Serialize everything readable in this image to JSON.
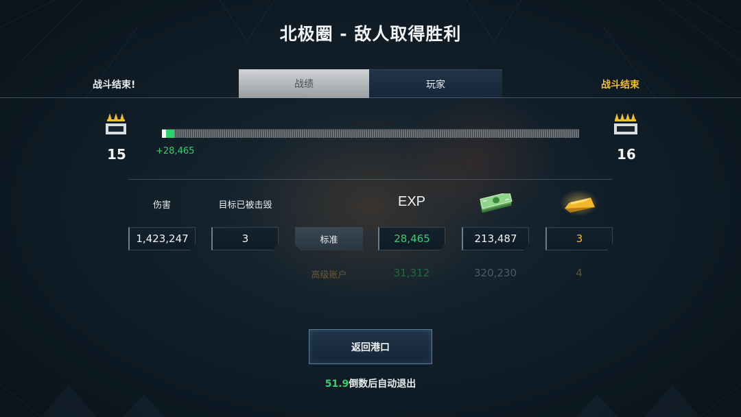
{
  "header": {
    "title": "北极圈 - 敌人取得胜利",
    "left_status": "战斗结束!",
    "right_status": "战斗结束"
  },
  "tabs": [
    {
      "label": "战绩",
      "active": true
    },
    {
      "label": "玩家",
      "active": false
    }
  ],
  "teams": {
    "left": {
      "score": "15",
      "icon": "rank-icon"
    },
    "right": {
      "score": "16",
      "icon": "rank-icon"
    }
  },
  "progress": {
    "gain_text": "+28,465",
    "fill_fraction": 0.03
  },
  "columns": {
    "damage": "伤害",
    "targets_destroyed": "目标已被击毁",
    "exp": "EXP",
    "credits_icon": "money-icon",
    "gold_icon": "gold-bar-icon"
  },
  "standard_row": {
    "label": "标准",
    "damage": "1,423,247",
    "targets_destroyed": "3",
    "exp": "28,465",
    "credits": "213,487",
    "gold": "3"
  },
  "premium_row": {
    "label": "高级账户",
    "exp": "31,312",
    "credits": "320,230",
    "gold": "4"
  },
  "footer": {
    "return_button": "返回港口",
    "countdown_value": "51.9",
    "countdown_text": "倒数后自动退出"
  },
  "colors": {
    "accent_green": "#2fd46d",
    "gold": "#f1bf2c"
  }
}
